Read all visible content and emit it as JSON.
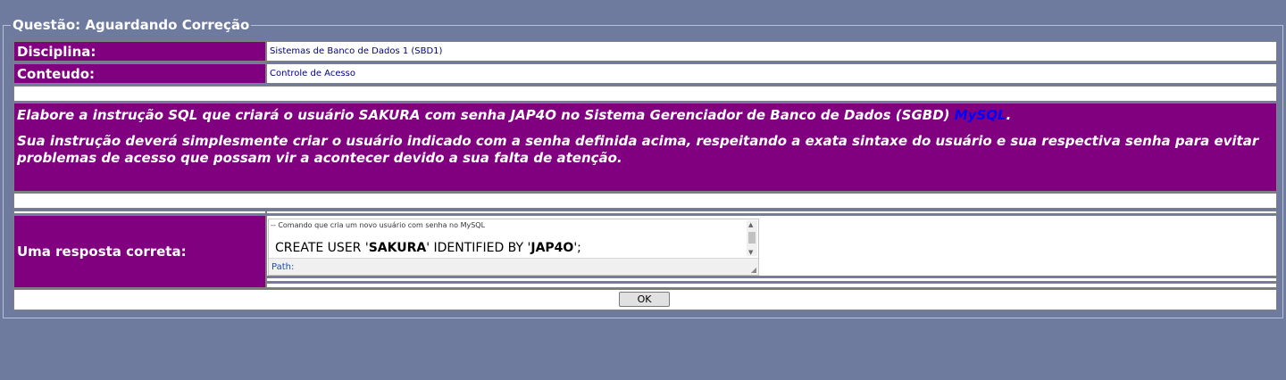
{
  "panel": {
    "legend": "Questão: Aguardando Correção"
  },
  "info": {
    "disciplina_label": "Disciplina:",
    "disciplina_value": "Sistemas de Banco de Dados 1 (SBD1)",
    "conteudo_label": "Conteudo:",
    "conteudo_value": "Controle de Acesso"
  },
  "question": {
    "line1_before": "Elabore a instrução SQL que criará o usuário SAKURA com senha JAP4O no Sistema Gerenciador de Banco de Dados (SGBD) ",
    "line1_link": "MySQL",
    "line1_after": ".",
    "line2": "Sua instrução deverá simplesmente criar o usuário indicado com a senha definida acima, respeitando a exata sintaxe do usuário e sua respectiva senha para evitar problemas de acesso que possam vir a acontecer devido a sua falta de atenção."
  },
  "answer": {
    "label": "Uma resposta correta:",
    "comment": "-- Comando que cria um novo usuário com senha no MySQL",
    "code_part1": "CREATE USER '",
    "code_user": "SAKURA",
    "code_part2": "' IDENTIFIED BY '",
    "code_password": "JAP4O",
    "code_part3": "';",
    "path_label": "Path:"
  },
  "actions": {
    "ok_label": "OK"
  }
}
